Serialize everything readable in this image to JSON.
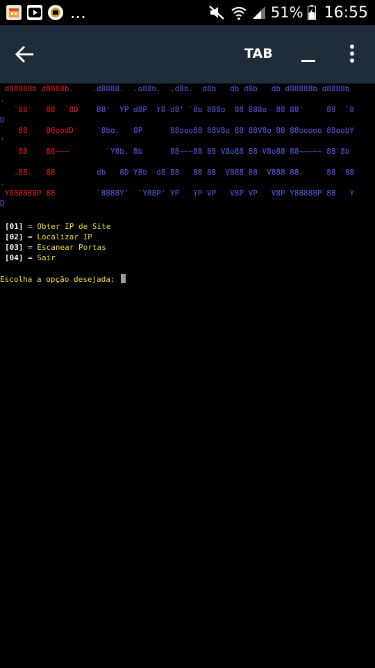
{
  "status_bar": {
    "left_icons": [
      "calendar-app-icon",
      "youtube-icon",
      "tv-app-icon"
    ],
    "more_indicator": "...",
    "battery_percent": "51%",
    "time": "16:55",
    "right_icons": [
      "mute-icon",
      "wifi-icon",
      "signal-icon",
      "battery-icon"
    ]
  },
  "toolbar": {
    "tab_label": "TAB"
  },
  "terminal": {
    "banner": [
      [
        {
          "t": " d88888b d8888b.",
          "c": "red"
        },
        {
          "t": "    .d8888.  .o88b.  .d8b.  d8b   db d8b   db d88888b d8888b",
          "c": "blue"
        }
      ],
      [
        {
          "t": ".",
          "c": "blue"
        }
      ],
      [
        {
          "t": "   `88'   88  `8D",
          "c": "red"
        },
        {
          "t": "    88'  YP d8P  Y8 d8' `8b 888o  88 888o  88 88'     88  `8",
          "c": "blue"
        }
      ],
      [
        {
          "t": "D",
          "c": "blue"
        }
      ],
      [
        {
          "t": "    88    88oodD'",
          "c": "red"
        },
        {
          "t": "    `8bo.   8P      88ooo88 88V8o 88 88V8o 88 88ooooo 88oobY",
          "c": "blue"
        }
      ],
      [
        {
          "t": "'",
          "c": "blue"
        }
      ],
      [
        {
          "t": "    88    88~~~",
          "c": "red"
        },
        {
          "t": "        `Y8b. 8b      88~~~88 88 V8o88 88 V8o88 88~~~~~ 88`8b",
          "c": "blue"
        }
      ],
      [
        {
          "t": "",
          "c": "blue"
        }
      ],
      [
        {
          "t": "   .88.   88",
          "c": "red"
        },
        {
          "t": "         db   8D Y8b  d8 88   88 88  V888 88  V888 88.     88 `88",
          "c": "blue"
        }
      ],
      [
        {
          "t": ".",
          "c": "blue"
        }
      ],
      [
        {
          "t": " Y888888P 88",
          "c": "red"
        },
        {
          "t": "         `8888Y'  `Y88P' YP   YP VP   V8P VP   V8P Y88888P 88   Y",
          "c": "blue"
        }
      ],
      [
        {
          "t": "D",
          "c": "blue"
        }
      ]
    ],
    "menu": [
      {
        "key": "[01]",
        "eq": "=",
        "label": "Obter IP de Site"
      },
      {
        "key": "[02]",
        "eq": "=",
        "label": "Localizar IP"
      },
      {
        "key": "[03]",
        "eq": "=",
        "label": "Escanear Portas"
      },
      {
        "key": "[04]",
        "eq": "=",
        "label": "Sair"
      }
    ],
    "prompt": "Escolha a opção desejada: "
  },
  "colors": {
    "toolbar_bg": "#1f2d3b",
    "banner_red": "#e02020",
    "banner_blue": "#5a5ce6",
    "menu_label_yellow": "#e6e04a"
  }
}
